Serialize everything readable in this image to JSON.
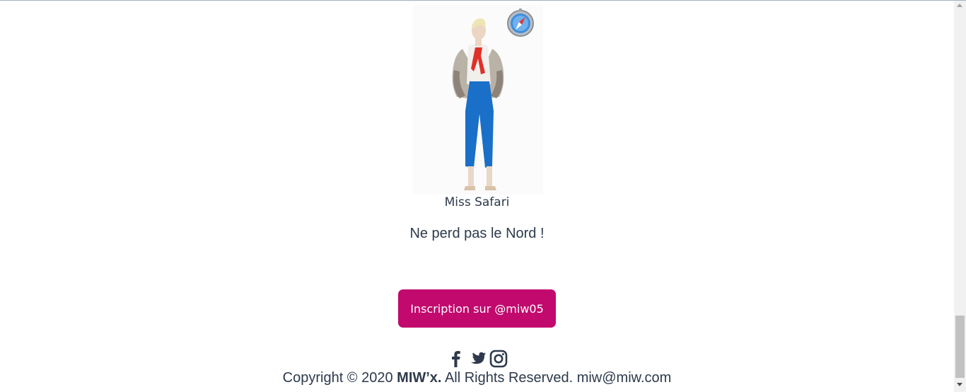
{
  "product": {
    "image_alt": "Miss Safari",
    "badge_icon": "safari-compass-icon",
    "caption": "Miss Safari",
    "tagline": "Ne perd pas le Nord !"
  },
  "cta": {
    "label": "Inscription sur @miw05",
    "color": "#c2096e"
  },
  "social": {
    "icons": [
      "facebook-icon",
      "twitter-icon",
      "instagram-icon"
    ]
  },
  "footer": {
    "prefix": "Copyright © 2020 ",
    "brand": "MIW’x.",
    "suffix": " All Rights Reserved. miw@miw.com"
  }
}
